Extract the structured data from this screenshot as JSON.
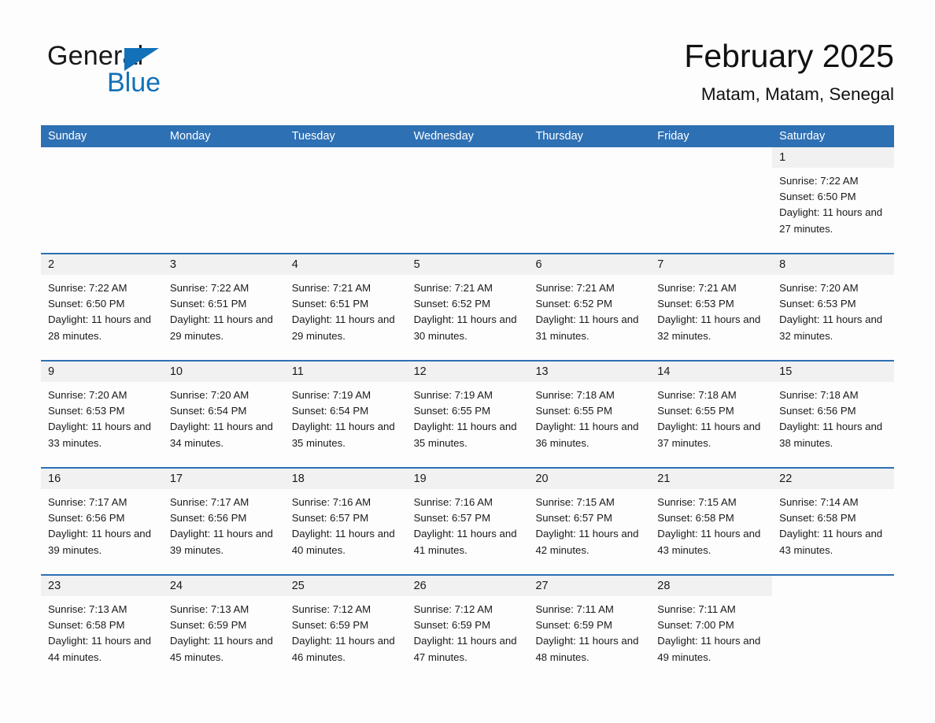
{
  "brand": {
    "name_part1": "General",
    "name_part2": "Blue",
    "accent_color": "#1271b8"
  },
  "header": {
    "month_title": "February 2025",
    "location": "Matam, Matam, Senegal"
  },
  "colors": {
    "header_blue": "#2e70b4",
    "daynum_band": "#f1f1f1",
    "page_background": "#fdfdfd",
    "text": "#1a1a1a"
  },
  "calendar": {
    "weekday_headers": [
      "Sunday",
      "Monday",
      "Tuesday",
      "Wednesday",
      "Thursday",
      "Friday",
      "Saturday"
    ],
    "weeks": [
      [
        {
          "day": "",
          "empty": true
        },
        {
          "day": "",
          "empty": true
        },
        {
          "day": "",
          "empty": true
        },
        {
          "day": "",
          "empty": true
        },
        {
          "day": "",
          "empty": true
        },
        {
          "day": "",
          "empty": true
        },
        {
          "day": "1",
          "sunrise": "Sunrise: 7:22 AM",
          "sunset": "Sunset: 6:50 PM",
          "daylight": "Daylight: 11 hours and 27 minutes."
        }
      ],
      [
        {
          "day": "2",
          "sunrise": "Sunrise: 7:22 AM",
          "sunset": "Sunset: 6:50 PM",
          "daylight": "Daylight: 11 hours and 28 minutes."
        },
        {
          "day": "3",
          "sunrise": "Sunrise: 7:22 AM",
          "sunset": "Sunset: 6:51 PM",
          "daylight": "Daylight: 11 hours and 29 minutes."
        },
        {
          "day": "4",
          "sunrise": "Sunrise: 7:21 AM",
          "sunset": "Sunset: 6:51 PM",
          "daylight": "Daylight: 11 hours and 29 minutes."
        },
        {
          "day": "5",
          "sunrise": "Sunrise: 7:21 AM",
          "sunset": "Sunset: 6:52 PM",
          "daylight": "Daylight: 11 hours and 30 minutes."
        },
        {
          "day": "6",
          "sunrise": "Sunrise: 7:21 AM",
          "sunset": "Sunset: 6:52 PM",
          "daylight": "Daylight: 11 hours and 31 minutes."
        },
        {
          "day": "7",
          "sunrise": "Sunrise: 7:21 AM",
          "sunset": "Sunset: 6:53 PM",
          "daylight": "Daylight: 11 hours and 32 minutes."
        },
        {
          "day": "8",
          "sunrise": "Sunrise: 7:20 AM",
          "sunset": "Sunset: 6:53 PM",
          "daylight": "Daylight: 11 hours and 32 minutes."
        }
      ],
      [
        {
          "day": "9",
          "sunrise": "Sunrise: 7:20 AM",
          "sunset": "Sunset: 6:53 PM",
          "daylight": "Daylight: 11 hours and 33 minutes."
        },
        {
          "day": "10",
          "sunrise": "Sunrise: 7:20 AM",
          "sunset": "Sunset: 6:54 PM",
          "daylight": "Daylight: 11 hours and 34 minutes."
        },
        {
          "day": "11",
          "sunrise": "Sunrise: 7:19 AM",
          "sunset": "Sunset: 6:54 PM",
          "daylight": "Daylight: 11 hours and 35 minutes."
        },
        {
          "day": "12",
          "sunrise": "Sunrise: 7:19 AM",
          "sunset": "Sunset: 6:55 PM",
          "daylight": "Daylight: 11 hours and 35 minutes."
        },
        {
          "day": "13",
          "sunrise": "Sunrise: 7:18 AM",
          "sunset": "Sunset: 6:55 PM",
          "daylight": "Daylight: 11 hours and 36 minutes."
        },
        {
          "day": "14",
          "sunrise": "Sunrise: 7:18 AM",
          "sunset": "Sunset: 6:55 PM",
          "daylight": "Daylight: 11 hours and 37 minutes."
        },
        {
          "day": "15",
          "sunrise": "Sunrise: 7:18 AM",
          "sunset": "Sunset: 6:56 PM",
          "daylight": "Daylight: 11 hours and 38 minutes."
        }
      ],
      [
        {
          "day": "16",
          "sunrise": "Sunrise: 7:17 AM",
          "sunset": "Sunset: 6:56 PM",
          "daylight": "Daylight: 11 hours and 39 minutes."
        },
        {
          "day": "17",
          "sunrise": "Sunrise: 7:17 AM",
          "sunset": "Sunset: 6:56 PM",
          "daylight": "Daylight: 11 hours and 39 minutes."
        },
        {
          "day": "18",
          "sunrise": "Sunrise: 7:16 AM",
          "sunset": "Sunset: 6:57 PM",
          "daylight": "Daylight: 11 hours and 40 minutes."
        },
        {
          "day": "19",
          "sunrise": "Sunrise: 7:16 AM",
          "sunset": "Sunset: 6:57 PM",
          "daylight": "Daylight: 11 hours and 41 minutes."
        },
        {
          "day": "20",
          "sunrise": "Sunrise: 7:15 AM",
          "sunset": "Sunset: 6:57 PM",
          "daylight": "Daylight: 11 hours and 42 minutes."
        },
        {
          "day": "21",
          "sunrise": "Sunrise: 7:15 AM",
          "sunset": "Sunset: 6:58 PM",
          "daylight": "Daylight: 11 hours and 43 minutes."
        },
        {
          "day": "22",
          "sunrise": "Sunrise: 7:14 AM",
          "sunset": "Sunset: 6:58 PM",
          "daylight": "Daylight: 11 hours and 43 minutes."
        }
      ],
      [
        {
          "day": "23",
          "sunrise": "Sunrise: 7:13 AM",
          "sunset": "Sunset: 6:58 PM",
          "daylight": "Daylight: 11 hours and 44 minutes."
        },
        {
          "day": "24",
          "sunrise": "Sunrise: 7:13 AM",
          "sunset": "Sunset: 6:59 PM",
          "daylight": "Daylight: 11 hours and 45 minutes."
        },
        {
          "day": "25",
          "sunrise": "Sunrise: 7:12 AM",
          "sunset": "Sunset: 6:59 PM",
          "daylight": "Daylight: 11 hours and 46 minutes."
        },
        {
          "day": "26",
          "sunrise": "Sunrise: 7:12 AM",
          "sunset": "Sunset: 6:59 PM",
          "daylight": "Daylight: 11 hours and 47 minutes."
        },
        {
          "day": "27",
          "sunrise": "Sunrise: 7:11 AM",
          "sunset": "Sunset: 6:59 PM",
          "daylight": "Daylight: 11 hours and 48 minutes."
        },
        {
          "day": "28",
          "sunrise": "Sunrise: 7:11 AM",
          "sunset": "Sunset: 7:00 PM",
          "daylight": "Daylight: 11 hours and 49 minutes."
        },
        {
          "day": "",
          "empty": true
        }
      ]
    ]
  }
}
